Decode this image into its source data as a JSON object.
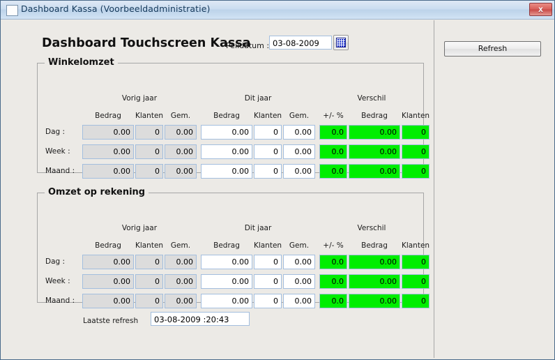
{
  "window": {
    "title": "Dashboard Kassa (Voorbeeldadministratie)",
    "close_label": "x",
    "icon": "window-icon"
  },
  "header": {
    "page_title": "Dashboard Touchscreen Kassa",
    "peildatum_label": "Peildatum :",
    "peildatum_value": "03-08-2009",
    "calendar_icon": "calendar-icon",
    "refresh_label": "Refresh"
  },
  "columns": {
    "groups": [
      "Vorig jaar",
      "Dit jaar",
      "Verschil"
    ],
    "sub": [
      "Bedrag",
      "Klanten",
      "Gem.",
      "Bedrag",
      "Klanten",
      "Gem.",
      "+/- %",
      "Bedrag",
      "Klanten"
    ]
  },
  "sections": [
    {
      "title": "Winkelomzet",
      "rows": [
        {
          "label": "Dag :",
          "values": [
            "0.00",
            "0",
            "0.00",
            "0.00",
            "0",
            "0.00",
            "0.0",
            "0.00",
            "0"
          ]
        },
        {
          "label": "Week :",
          "values": [
            "0.00",
            "0",
            "0.00",
            "0.00",
            "0",
            "0.00",
            "0.0",
            "0.00",
            "0"
          ]
        },
        {
          "label": "Maand :",
          "values": [
            "0.00",
            "0",
            "0.00",
            "0.00",
            "0",
            "0.00",
            "0.0",
            "0.00",
            "0"
          ]
        }
      ]
    },
    {
      "title": "Omzet op rekening",
      "rows": [
        {
          "label": "Dag :",
          "values": [
            "0.00",
            "0",
            "0.00",
            "0.00",
            "0",
            "0.00",
            "0.0",
            "0.00",
            "0"
          ]
        },
        {
          "label": "Week :",
          "values": [
            "0.00",
            "0",
            "0.00",
            "0.00",
            "0",
            "0.00",
            "0.0",
            "0.00",
            "0"
          ]
        },
        {
          "label": "Maand :",
          "values": [
            "0.00",
            "0",
            "0.00",
            "0.00",
            "0",
            "0.00",
            "0.0",
            "0.00",
            "0"
          ]
        }
      ]
    }
  ],
  "footer": {
    "laatste_label": "Laatste refresh",
    "laatste_value": "03-08-2009 :20:43"
  },
  "colors": {
    "positive_green": "#00EE00",
    "readonly_gray": "#DCDCDC",
    "field_border": "#A3BEDE",
    "window_bg": "#ECEAE6"
  }
}
